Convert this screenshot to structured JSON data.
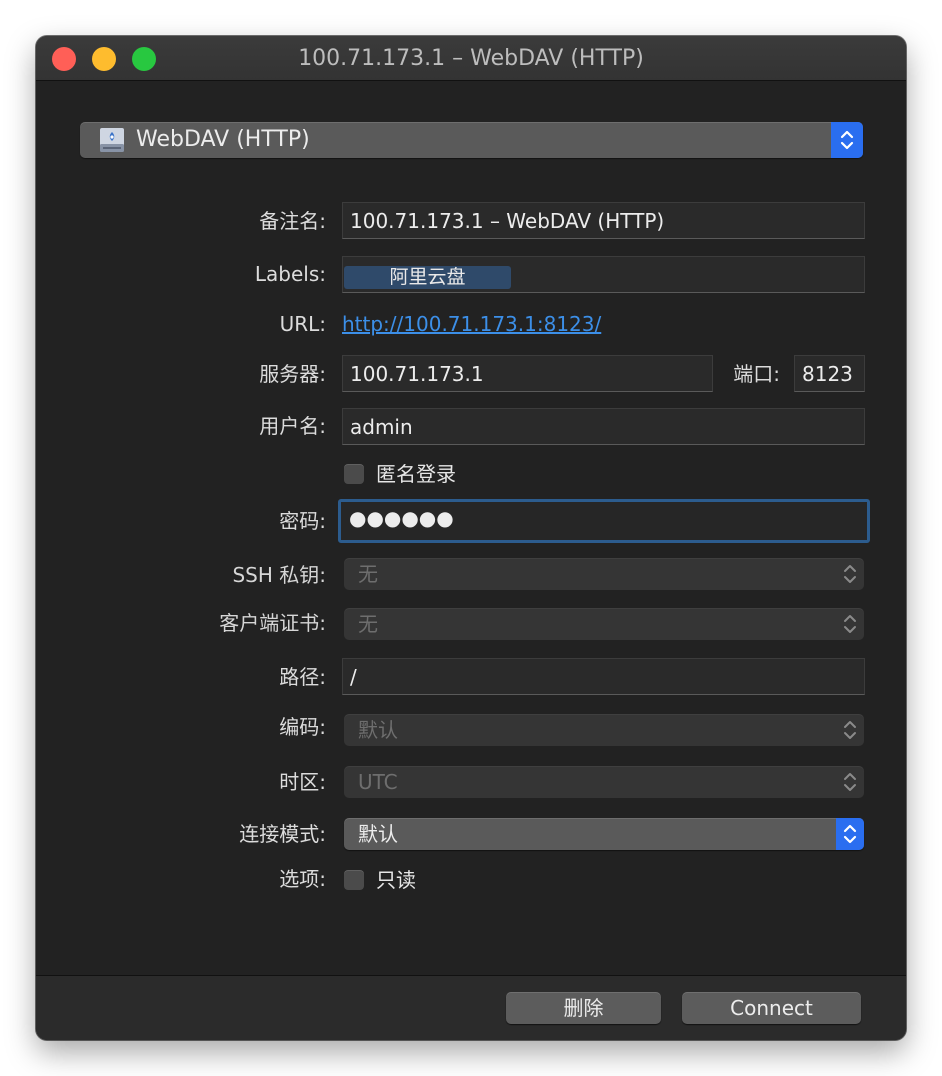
{
  "window": {
    "title": "100.71.173.1 – WebDAV (HTTP)"
  },
  "protocol": {
    "selected": "WebDAV (HTTP)",
    "icon": "webdav-drive-icon"
  },
  "form": {
    "nickname_label": "备注名:",
    "nickname_value": "100.71.173.1 – WebDAV (HTTP)",
    "labels_label": "Labels:",
    "labels_tag": "阿里云盘",
    "url_label": "URL:",
    "url_value": "http://100.71.173.1:8123/",
    "server_label": "服务器:",
    "server_value": "100.71.173.1",
    "port_label": "端口:",
    "port_value": "8123",
    "username_label": "用户名:",
    "username_value": "admin",
    "anonymous_label": "匿名登录",
    "anonymous_checked": false,
    "password_label": "密码:",
    "password_value": "●●●●●●",
    "ssh_key_label": "SSH 私钥:",
    "ssh_key_value": "无",
    "client_cert_label": "客户端证书:",
    "client_cert_value": "无",
    "path_label": "路径:",
    "path_value": "/",
    "encoding_label": "编码:",
    "encoding_value": "默认",
    "timezone_label": "时区:",
    "timezone_value": "UTC",
    "connect_mode_label": "连接模式:",
    "connect_mode_value": "默认",
    "options_label": "选项:",
    "readonly_label": "只读",
    "readonly_checked": false
  },
  "footer": {
    "delete_label": "删除",
    "connect_label": "Connect"
  },
  "colors": {
    "window_bg": "#222222",
    "accent_blue": "#2a6ef0",
    "link_blue": "#3c8fe8",
    "tag_bg": "#2f4a6a",
    "close": "#ff5f57",
    "minimize": "#febc2e",
    "maximize": "#28c840"
  }
}
